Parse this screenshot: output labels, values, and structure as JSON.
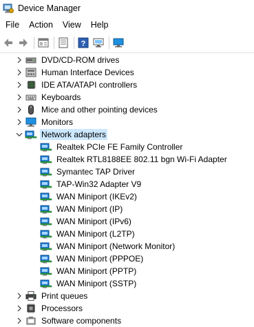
{
  "window": {
    "title": "Device Manager"
  },
  "menu": [
    "File",
    "Action",
    "View",
    "Help"
  ],
  "toolbar": [
    "back-icon",
    "forward-icon",
    "properties-icon",
    "update-driver-icon",
    "help-icon",
    "scan-hardware-icon"
  ],
  "tree": {
    "categories_before": [
      {
        "label": "DVD/CD-ROM drives",
        "icon": "dvd-drive-icon",
        "expanded": false
      },
      {
        "label": "Human Interface Devices",
        "icon": "hid-icon",
        "expanded": false
      },
      {
        "label": "IDE ATA/ATAPI controllers",
        "icon": "ide-controller-icon",
        "expanded": false
      },
      {
        "label": "Keyboards",
        "icon": "keyboard-icon",
        "expanded": false
      },
      {
        "label": "Mice and other pointing devices",
        "icon": "mouse-icon",
        "expanded": false
      },
      {
        "label": "Monitors",
        "icon": "monitor-icon",
        "expanded": false
      }
    ],
    "network": {
      "label": "Network adapters",
      "icon": "network-adapter-icon",
      "expanded": true,
      "selected": true,
      "children": [
        "Realtek PCIe FE Family Controller",
        "Realtek RTL8188EE 802.11 bgn Wi-Fi Adapter",
        "Symantec TAP Driver",
        "TAP-Win32 Adapter V9",
        "WAN Miniport (IKEv2)",
        "WAN Miniport (IP)",
        "WAN Miniport (IPv6)",
        "WAN Miniport (L2TP)",
        "WAN Miniport (Network Monitor)",
        "WAN Miniport (PPPOE)",
        "WAN Miniport (PPTP)",
        "WAN Miniport (SSTP)"
      ]
    },
    "categories_after": [
      {
        "label": "Print queues",
        "icon": "printer-icon",
        "expanded": false
      },
      {
        "label": "Processors",
        "icon": "processor-icon",
        "expanded": false
      },
      {
        "label": "Software components",
        "icon": "software-component-icon",
        "expanded": false
      }
    ]
  },
  "colors": {
    "selection": "#cce8ff",
    "adapter_blue": "#1e7fd8",
    "adapter_green": "#2ea043"
  }
}
